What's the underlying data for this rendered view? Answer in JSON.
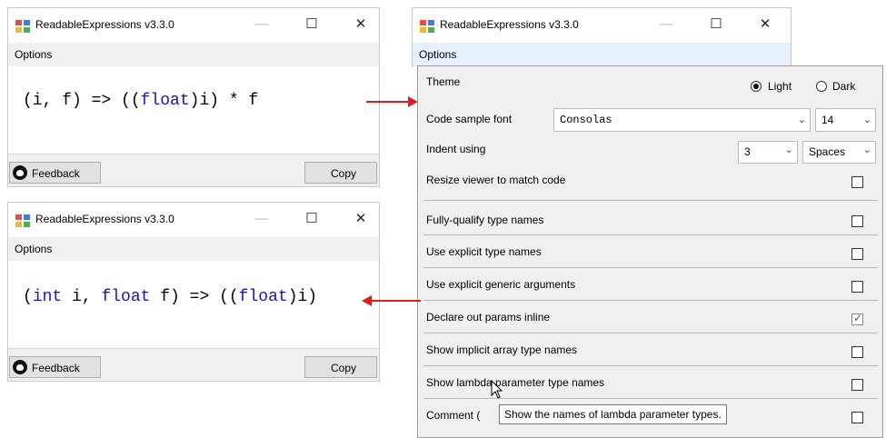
{
  "window_title": "ReadableExpressions v3.3.0",
  "menu_label": "Options",
  "top_viewer": {
    "code_tokens": [
      {
        "t": "(i, f) => ((",
        "kw": false
      },
      {
        "t": "float",
        "kw": true
      },
      {
        "t": ")i) * f",
        "kw": false
      }
    ],
    "feedback_label": "Feedback",
    "copy_label": "Copy"
  },
  "bottom_viewer": {
    "code_tokens": [
      {
        "t": "(",
        "kw": false
      },
      {
        "t": "int",
        "kw": true
      },
      {
        "t": " i, ",
        "kw": false
      },
      {
        "t": "float",
        "kw": true
      },
      {
        "t": " f) => ((",
        "kw": false
      },
      {
        "t": "float",
        "kw": true
      },
      {
        "t": ")i)",
        "kw": false
      }
    ],
    "feedback_label": "Feedback",
    "copy_label": "Copy"
  },
  "options": {
    "theme_label": "Theme",
    "theme_light": "Light",
    "theme_dark": "Dark",
    "font_label": "Code sample font",
    "font_value": "Consolas",
    "font_size": "14",
    "indent_label": "Indent using",
    "indent_count": "3",
    "indent_type": "Spaces",
    "resize_label": "Resize viewer to match code",
    "settings": [
      {
        "label": "Fully-qualify type names",
        "checked": false
      },
      {
        "label": "Use explicit type names",
        "checked": false
      },
      {
        "label": "Use explicit generic arguments",
        "checked": false
      },
      {
        "label": "Declare out params inline",
        "checked": true
      },
      {
        "label": "Show implicit array type names",
        "checked": false
      },
      {
        "label": "Show lambda parameter type names",
        "checked": false
      },
      {
        "label": "Comment (",
        "checked": false
      }
    ]
  },
  "tooltip": "Show the names of lambda parameter types.",
  "colors": {
    "keyword": "#1212c8",
    "arrow": "#e01d1d"
  }
}
